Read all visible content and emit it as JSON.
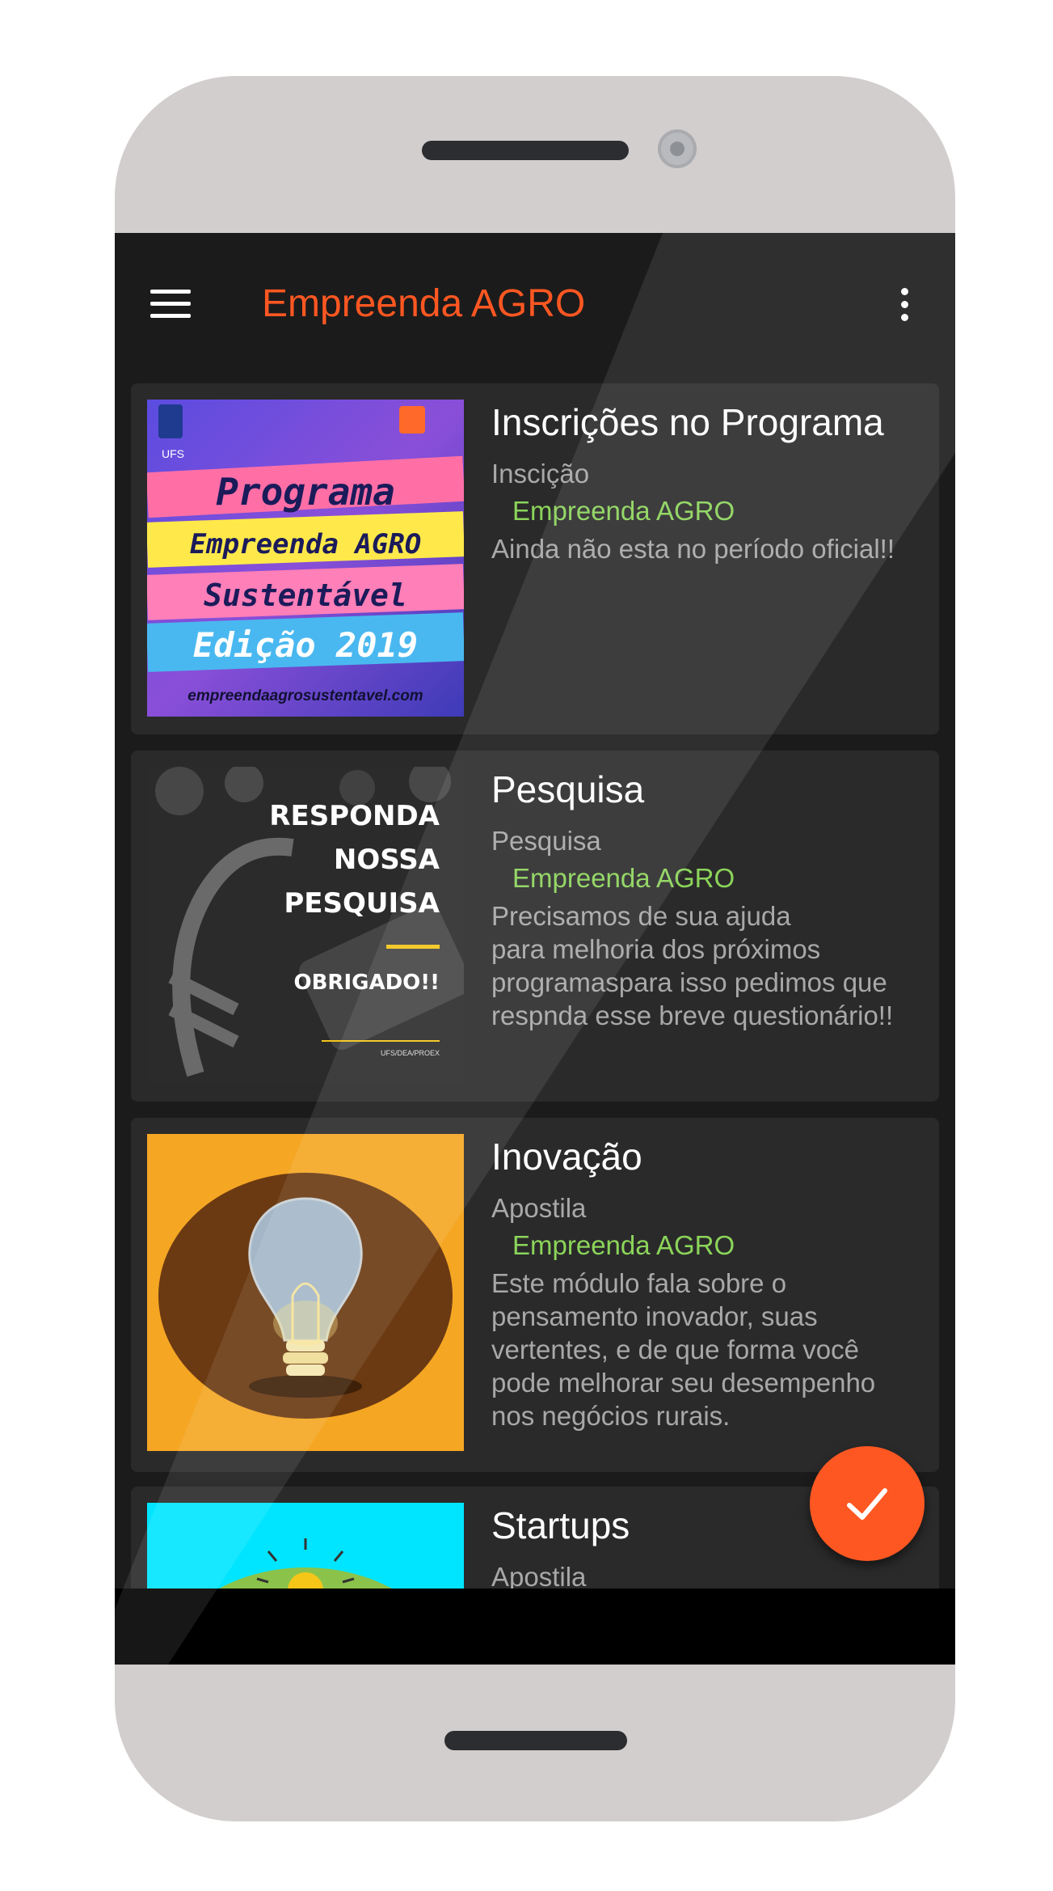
{
  "app": {
    "title": "Empreenda AGRO",
    "accent_color": "#ff5722",
    "author_color": "#8bd45a",
    "menu_icon": "hamburger-menu-icon",
    "overflow_icon": "more-vert-icon"
  },
  "cards": [
    {
      "title": "Inscrições no Programa",
      "category": "Inscição",
      "author": "Empreenda AGRO",
      "description": "Ainda não esta no período oficial!!",
      "thumb": {
        "line1": "Programa",
        "line2": "Empreenda AGRO",
        "line3": "Sustentável",
        "line4": "Edição 2019",
        "url": "empreendaagrosustentavel.com",
        "badge": "UFS"
      }
    },
    {
      "title": "Pesquisa",
      "category": "Pesquisa",
      "author": "Empreenda AGRO",
      "description": "Precisamos de sua ajuda\npara melhoria dos próximos\nprogramaspara isso pedimos que\nrespnda esse breve questionário!!",
      "thumb": {
        "line1": "RESPONDA",
        "line2": "NOSSA",
        "line3": "PESQUISA",
        "line4": "OBRIGADO!!",
        "footer": "UFS/DEA/PROEX"
      }
    },
    {
      "title": "Inovação",
      "category": "Apostila",
      "author": "Empreenda AGRO",
      "description": "Este módulo fala sobre o\npensamento inovador, suas\nvertentes, e de que forma você\npode  melhorar seu desempenho\nnos negócios rurais.",
      "thumb": {
        "icon": "lightbulb-icon"
      }
    },
    {
      "title": "Startups",
      "category": "Apostila",
      "author": "",
      "description": "",
      "thumb": {
        "icon": "lightbulb-icon"
      }
    }
  ],
  "fab": {
    "icon": "check-icon"
  }
}
